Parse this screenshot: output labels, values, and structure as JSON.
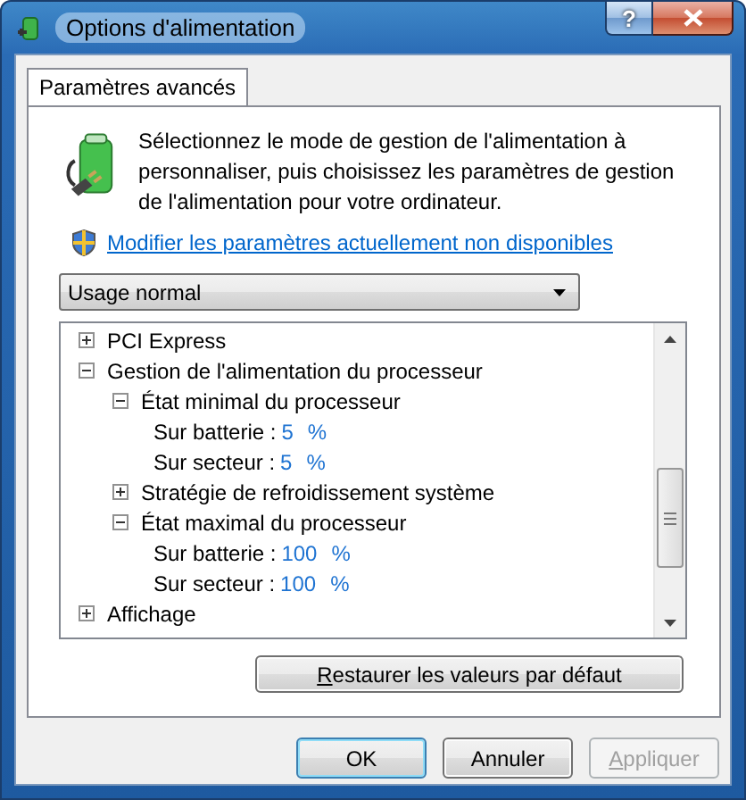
{
  "window": {
    "title": "Options d'alimentation",
    "help_button": "?"
  },
  "tabs": [
    {
      "label": "Paramètres avancés",
      "selected": true
    }
  ],
  "description": "Sélectionnez le mode de gestion de l'alimentation à personnaliser, puis choisissez les paramètres de gestion de l'alimentation pour votre ordinateur.",
  "link": "Modifier les paramètres actuellement non disponibles",
  "plan_dropdown": {
    "value": "Usage normal"
  },
  "tree": [
    {
      "kind": "group",
      "label": "PCI Express",
      "expanded": false
    },
    {
      "kind": "group",
      "label": "Gestion de l'alimentation du processeur",
      "expanded": true,
      "children": [
        {
          "kind": "group",
          "label": "État minimal du processeur",
          "expanded": true,
          "children": [
            {
              "kind": "setting",
              "label": "Sur batterie :",
              "value": "5",
              "unit": "%"
            },
            {
              "kind": "setting",
              "label": "Sur secteur :",
              "value": "5",
              "unit": "%"
            }
          ]
        },
        {
          "kind": "group",
          "label": "Stratégie de refroidissement système",
          "expanded": false
        },
        {
          "kind": "group",
          "label": "État maximal du processeur",
          "expanded": true,
          "children": [
            {
              "kind": "setting",
              "label": "Sur batterie :",
              "value": "100",
              "unit": "%"
            },
            {
              "kind": "setting",
              "label": "Sur secteur :",
              "value": "100",
              "unit": "%"
            }
          ]
        }
      ]
    },
    {
      "kind": "group",
      "label": "Affichage",
      "expanded": false
    }
  ],
  "restore_button": "Restaurer les valeurs par défaut",
  "dialog_buttons": [
    {
      "label": "OK",
      "focused": true,
      "disabled": false
    },
    {
      "label": "Annuler",
      "focused": false,
      "disabled": false
    },
    {
      "label": "Appliquer",
      "focused": false,
      "disabled": true
    }
  ]
}
